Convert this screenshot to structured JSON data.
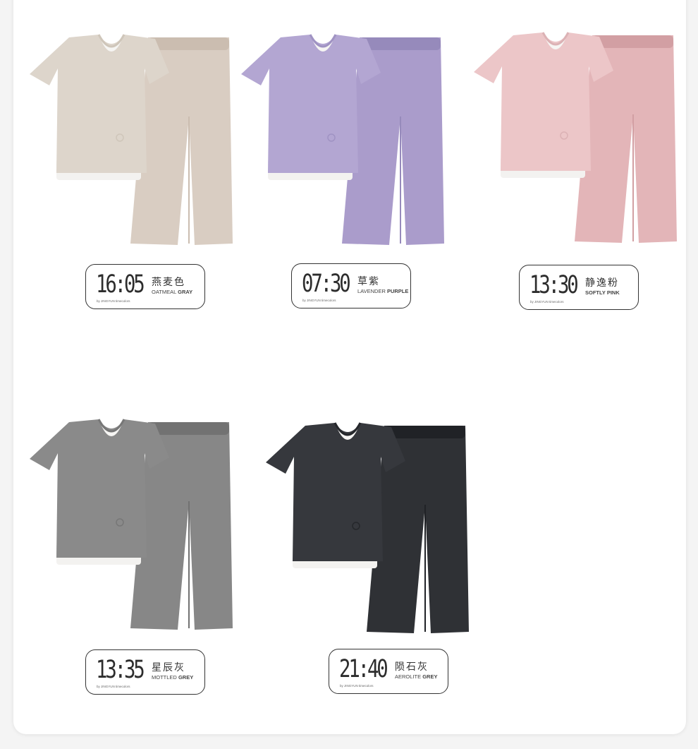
{
  "brand_line": "by JINGYUN timecolors",
  "products": [
    {
      "time": "16:05",
      "name_cn": "燕麦色",
      "name_en_light": "OATMEAL",
      "name_en_bold": "GRAY",
      "top_color": "#ddd5cb",
      "top_shade": "#cfc6ba",
      "pant_color": "#d9cdc2",
      "pant_shade": "#cbbdb0"
    },
    {
      "time": "07:30",
      "name_cn": "草紫",
      "name_en_light": "LAVENDER",
      "name_en_bold": "PURPLE",
      "top_color": "#b3a6d2",
      "top_shade": "#a093c3",
      "pant_color": "#aa9ccb",
      "pant_shade": "#968abb"
    },
    {
      "time": "13:30",
      "name_cn": "静逸粉",
      "name_en_light": "",
      "name_en_bold": "SOFTLY PINK",
      "top_color": "#ecc6c8",
      "top_shade": "#dcb2b5",
      "pant_color": "#e3b5b8",
      "pant_shade": "#d29fa3"
    },
    {
      "time": "13:35",
      "name_cn": "星辰灰",
      "name_en_light": "MOTTLED",
      "name_en_bold": "GREY",
      "top_color": "#8a8a8a",
      "top_shade": "#777777",
      "pant_color": "#878787",
      "pant_shade": "#727272"
    },
    {
      "time": "21:40",
      "name_cn": "陨石灰",
      "name_en_light": "AEROLITE",
      "name_en_bold": "GREY",
      "top_color": "#36383d",
      "top_shade": "#25272b",
      "pant_color": "#2f3135",
      "pant_shade": "#202226"
    }
  ]
}
